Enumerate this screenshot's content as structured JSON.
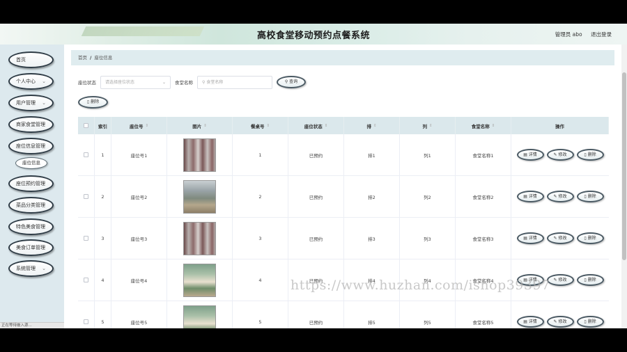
{
  "header": {
    "title": "高校食堂移动预约点餐系统",
    "user_label": "管理员 abo",
    "logout_label": "退出登录"
  },
  "sidebar": {
    "items": [
      {
        "label": "首页",
        "has_arrow": false
      },
      {
        "label": "个人中心",
        "has_arrow": true
      },
      {
        "label": "用户管理",
        "has_arrow": true
      },
      {
        "label": "商家食堂管理",
        "has_arrow": false
      },
      {
        "label": "座位信息管理",
        "has_arrow": false
      },
      {
        "label": "座位预约管理",
        "has_arrow": false
      },
      {
        "label": "菜品分类管理",
        "has_arrow": false
      },
      {
        "label": "特色美食管理",
        "has_arrow": false
      },
      {
        "label": "美食订单管理",
        "has_arrow": false
      },
      {
        "label": "系统管理",
        "has_arrow": true
      }
    ],
    "submenu_label": "座位信息",
    "status_text": "正在等待嵌入源..."
  },
  "breadcrumb": {
    "home": "首页",
    "current": "座位信息"
  },
  "search": {
    "status_label": "座位状态",
    "status_placeholder": "请选择座位状态",
    "canteen_label": "食堂名称",
    "canteen_placeholder": "食堂名称",
    "search_button": "查询",
    "delete_button": "删除"
  },
  "table": {
    "headers": [
      "索引",
      "座位号",
      "图片",
      "餐桌号",
      "座位状态",
      "排",
      "列",
      "食堂名称",
      "操作"
    ],
    "action_labels": {
      "detail": "详情",
      "edit": "修改",
      "delete": "删除"
    },
    "rows": [
      {
        "index": "1",
        "seat_no": "座位号1",
        "table_no": "1",
        "status": "已预约",
        "row": "排1",
        "col": "列1",
        "canteen": "食堂名称1",
        "img": "glass"
      },
      {
        "index": "2",
        "seat_no": "座位号2",
        "table_no": "2",
        "status": "已预约",
        "row": "排2",
        "col": "列2",
        "canteen": "食堂名称2",
        "img": "hall"
      },
      {
        "index": "3",
        "seat_no": "座位号3",
        "table_no": "3",
        "status": "已预约",
        "row": "排3",
        "col": "列3",
        "canteen": "食堂名称3",
        "img": "glass"
      },
      {
        "index": "4",
        "seat_no": "座位号4",
        "table_no": "4",
        "status": "已预约",
        "row": "排4",
        "col": "列4",
        "canteen": "食堂名称4",
        "img": "green"
      },
      {
        "index": "5",
        "seat_no": "座位号5",
        "table_no": "5",
        "status": "已预约",
        "row": "排5",
        "col": "列5",
        "canteen": "食堂名称5",
        "img": "green"
      }
    ]
  },
  "watermark": "https://www.huzhan.com/ishop39397",
  "colors": {
    "sidebar_bg": "#dde9ee",
    "header_row_bg": "#dbe8ec",
    "breadcrumb_bg": "#dfecef",
    "button_border": "#2e3b45"
  }
}
